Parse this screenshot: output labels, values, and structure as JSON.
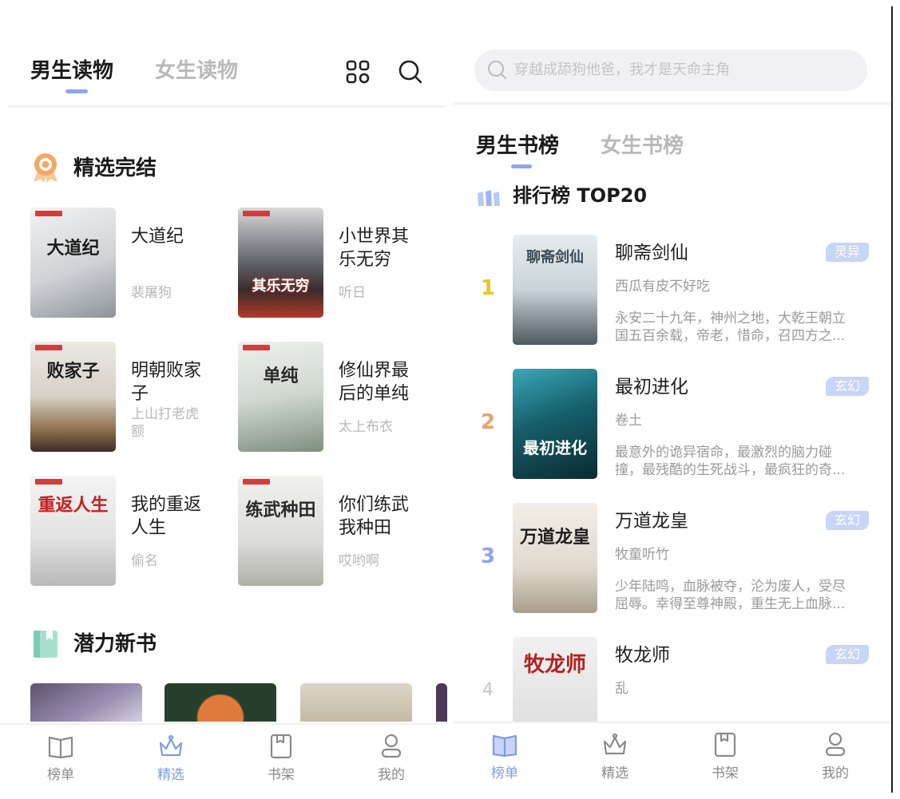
{
  "left": {
    "header": {
      "tab_active": "男生读物",
      "tab_inactive": "女生读物",
      "grid_icon": "grid-icon",
      "search_icon": "search-icon"
    },
    "sections": {
      "featured_title": "精选完结",
      "potential_title": "潜力新书"
    },
    "books": [
      {
        "title_lines": [
          "大道纪"
        ],
        "author_lines": [
          "裴屠狗"
        ],
        "cover_text": "大道纪"
      },
      {
        "title_lines": [
          "小世界其",
          "乐无穷"
        ],
        "author_lines": [
          "听日"
        ],
        "cover_text": "其乐无穷"
      },
      {
        "title_lines": [
          "明朝败家",
          "子"
        ],
        "author_lines": [
          "上山打老虎",
          "额"
        ],
        "cover_text": "败家子"
      },
      {
        "title_lines": [
          "修仙界最",
          "后的单纯"
        ],
        "author_lines": [
          "太上布衣"
        ],
        "cover_text": "单纯"
      },
      {
        "title_lines": [
          "我的重返",
          "人生"
        ],
        "author_lines": [
          "偷名"
        ],
        "cover_text": "重返人生"
      },
      {
        "title_lines": [
          "你们练武",
          "我种田"
        ],
        "author_lines": [
          "哎哟啊"
        ],
        "cover_text": "练武种田"
      }
    ],
    "nav": [
      {
        "label": "榜单",
        "icon": "book-open-icon",
        "active": false
      },
      {
        "label": "精选",
        "icon": "crown-icon",
        "active": true
      },
      {
        "label": "书架",
        "icon": "bookshelf-icon",
        "active": false
      },
      {
        "label": "我的",
        "icon": "user-icon",
        "active": false
      }
    ]
  },
  "right": {
    "search_placeholder": "穿越成舔狗他爸，我才是天命主角",
    "tabs": {
      "active": "男生书榜",
      "inactive": "女生书榜"
    },
    "ranking_title": "排行榜 TOP20",
    "rank_items": [
      {
        "rank": "1",
        "title": "聊斋剑仙",
        "author": "西瓜有皮不好吃",
        "tag": "灵异",
        "desc_lines": [
          "永安二十九年，神州之地，大乾王朝立",
          "国五百余载，帝老，惜命，召四方之..."
        ],
        "cover_text": "聊斋剑仙"
      },
      {
        "rank": "2",
        "title": "最初进化",
        "author": "卷土",
        "tag": "玄幻",
        "desc_lines": [
          "最意外的诡异宿命，最激烈的脑力碰",
          "撞，最残酷的生死战斗，最疯狂的奇..."
        ],
        "cover_text": "最初进化"
      },
      {
        "rank": "3",
        "title": "万道龙皇",
        "author": "牧童听竹",
        "tag": "玄幻",
        "desc_lines": [
          "少年陆鸣，血脉被夺，沦为废人，受尽",
          "屈辱。幸得至尊神殿，重生无上血脉..."
        ],
        "cover_text": "万道龙皇"
      },
      {
        "rank": "4",
        "title": "牧龙师",
        "author": "乱",
        "tag": "玄幻",
        "desc_lines": [],
        "cover_text": "牧龙师"
      }
    ],
    "nav": [
      {
        "label": "榜单",
        "icon": "book-open-icon",
        "active": true
      },
      {
        "label": "精选",
        "icon": "crown-icon",
        "active": false
      },
      {
        "label": "书架",
        "icon": "bookshelf-icon",
        "active": false
      },
      {
        "label": "我的",
        "icon": "user-icon",
        "active": false
      }
    ]
  }
}
